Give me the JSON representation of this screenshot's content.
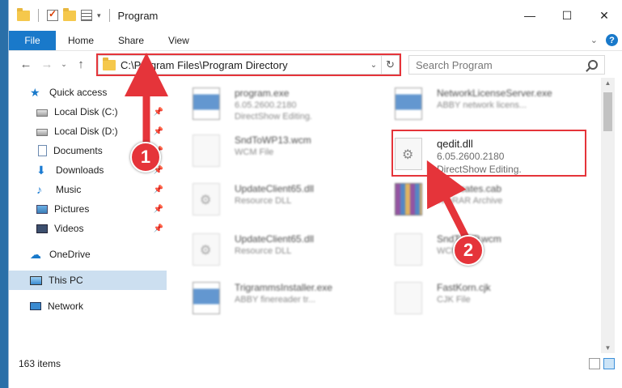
{
  "window": {
    "title": "Program",
    "controls": {
      "minimize": "—",
      "maximize": "☐",
      "close": "✕"
    }
  },
  "ribbon": {
    "tabs": [
      {
        "label": "File"
      },
      {
        "label": "Home"
      },
      {
        "label": "Share"
      },
      {
        "label": "View"
      }
    ]
  },
  "navbar": {
    "address": "C:\\Program Files\\Program Directory",
    "search_placeholder": "Search Program"
  },
  "sidebar": {
    "items": [
      {
        "label": "Quick access",
        "icon": "star-icon",
        "pinned": false
      },
      {
        "label": "Local Disk (C:)",
        "icon": "disk-icon",
        "pinned": true
      },
      {
        "label": "Local Disk (D:)",
        "icon": "disk-icon",
        "pinned": true
      },
      {
        "label": "Documents",
        "icon": "documents-icon",
        "pinned": true
      },
      {
        "label": "Downloads",
        "icon": "downloads-icon",
        "pinned": true
      },
      {
        "label": "Music",
        "icon": "music-icon",
        "pinned": true
      },
      {
        "label": "Pictures",
        "icon": "pictures-icon",
        "pinned": true
      },
      {
        "label": "Videos",
        "icon": "videos-icon",
        "pinned": true
      },
      {
        "label": "OneDrive",
        "icon": "onedrive-icon",
        "pinned": false
      },
      {
        "label": "This PC",
        "icon": "this-pc-icon",
        "pinned": false,
        "selected": true
      },
      {
        "label": "Network",
        "icon": "network-icon",
        "pinned": false
      }
    ]
  },
  "files": [
    {
      "name": "program.exe",
      "line2": "6.05.2600.2180",
      "line3": "DirectShow Editing.",
      "type": "exe"
    },
    {
      "name": "NetworkLicenseServer.exe",
      "line2": "ABBY network licens...",
      "line3": "",
      "type": "exe"
    },
    {
      "name": "SndToWP13.wcm",
      "line2": "WCM File",
      "line3": "",
      "type": "doc"
    },
    {
      "name": "qedit.dll",
      "line2": "6.05.2600.2180",
      "line3": "DirectShow Editing.",
      "type": "dll"
    },
    {
      "name": "UpdateClient65.dll",
      "line2": "Resource DLL",
      "line3": "",
      "type": "dll"
    },
    {
      "name": "certificates.cab",
      "line2": "WinRAR Archive",
      "line3": "",
      "type": "cab"
    },
    {
      "name": "UpdateClient65.dll",
      "line2": "Resource DLL",
      "line3": "",
      "type": "dll"
    },
    {
      "name": "SndToWP.wcm",
      "line2": "WCM File",
      "line3": "",
      "type": "doc"
    },
    {
      "name": "TrigrammsInstaller.exe",
      "line2": "ABBY finereader tr...",
      "line3": "",
      "type": "exe"
    },
    {
      "name": "FastKorn.cjk",
      "line2": "CJK File",
      "line3": "",
      "type": "doc"
    }
  ],
  "status": {
    "items_count": "163 items"
  },
  "annotations": {
    "step1": "1",
    "step2": "2",
    "highlight_color": "#e5343a"
  }
}
